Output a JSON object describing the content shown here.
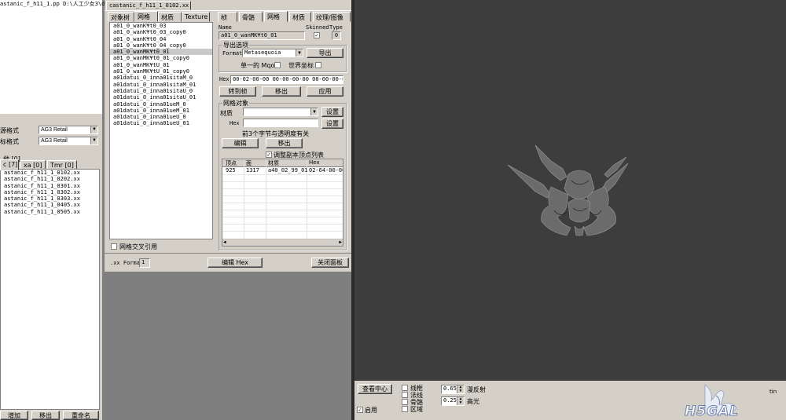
{
  "left_panel": {
    "title_path": "astanic_f_h11_1.pp  D:\\人工少女3\\data",
    "source_format_label": "源格式",
    "target_format_label": "标格式",
    "source_format_value": "AG3 Retail",
    "target_format_value": "AG3 Retail",
    "tabs": [
      "他 [0]",
      "c [7]",
      "xa [0]",
      "Tmr [0]"
    ],
    "files": [
      "astanic_f_h11_1_0102.xx",
      "astanic_f_h11_1_0202.xx",
      "astanic_f_h11_1_0301.xx",
      "astanic_f_h11_1_0302.xx",
      "astanic_f_h11_1_0303.xx",
      "astanic_f_h11_1_0405.xx",
      "astanic_f_h11_1_0505.xx"
    ],
    "buttons": {
      "add": "增加",
      "remove": "移出",
      "rename": "重命名"
    }
  },
  "editor": {
    "window_tab": "castanic_f_h11_1_0102.xx",
    "tree_tabs": [
      "对象树",
      "网格",
      "材质",
      "Texture"
    ],
    "mesh_list": [
      "a01_0_wanK¥t0_03",
      "a01_0_wanK¥t0_03_copy0",
      "a01_0_wanK¥t0_04",
      "a01_0_wanK¥t0_04_copy0",
      "a01_0_wanMK¥t0_01",
      "a01_0_wanMK¥t0_01_copy0",
      "a01_0_wanMK¥tU_01",
      "a01_0_wanMK¥tU_01_copy0",
      "a01datui_0_inna01sitaM_0",
      "a01datui_0_inna01sitaM_01",
      "a01datui_0_inna01sitaU_0",
      "a01datui_0_inna01sitaU_01",
      "a01datui_0_inna01ueM_0",
      "a01datui_0_inna01ueM_01",
      "a01datui_0_inna01ueU_0",
      "a01datui_0_inna01ueU_01"
    ],
    "selected_index": 4,
    "cross_ref_label": "网格交叉引用",
    "prop_tabs": [
      "桢",
      "骨骼",
      "网格",
      "材质",
      "纹理/图像"
    ],
    "name_label": "Name",
    "name_value": "a01_0_wanMK¥t0_01",
    "skinned_label": "Skinned",
    "type_label": "Type",
    "type_value": "0",
    "export_group": "导出选项",
    "format_label": "Format",
    "format_value": "Metasequoia",
    "export_button": "导出",
    "single_mqo_label": "单一的 Mqo",
    "world_coords_label": "世界坐标",
    "hex_label": "Hex",
    "hex_value": "00-02-00-00  00-00-00-00  00-00-00-00  0",
    "goto_frame_button": "转到桢",
    "remove_button": "移出",
    "apply_button": "应用",
    "mesh_obj_group": "网格对象",
    "material_label": "材质",
    "set_button": "设置",
    "hex2_label": "Hex",
    "set2_button": "设置",
    "note_text": "前3个字节与透明度有关",
    "edit_button": "编辑",
    "remove2_button": "移出",
    "adjust_label": "调整副本顶点列表",
    "table_headers": [
      "顶点",
      "面",
      "材质",
      "Hex"
    ],
    "table_row": [
      "925",
      "1317",
      "a40_02_99_01",
      "02-64-00-00"
    ],
    "bottom_format_label": ".xx Format",
    "bottom_format_value": "1",
    "edit_hex_button": "编辑 Hex",
    "close_panel_button": "关闭面板"
  },
  "viewport": {
    "view_center_button": "查看中心",
    "enable_label": "启用",
    "wireframe_label": "线框",
    "normals_label": "法线",
    "bones_label": "骨骼",
    "region_label": "区域",
    "diffuse_value": "0.65",
    "diffuse_label": "漫反射",
    "specular_value": "0.25",
    "specular_label": "高光",
    "watermark": "H5GAL",
    "corner_text": "tin"
  }
}
